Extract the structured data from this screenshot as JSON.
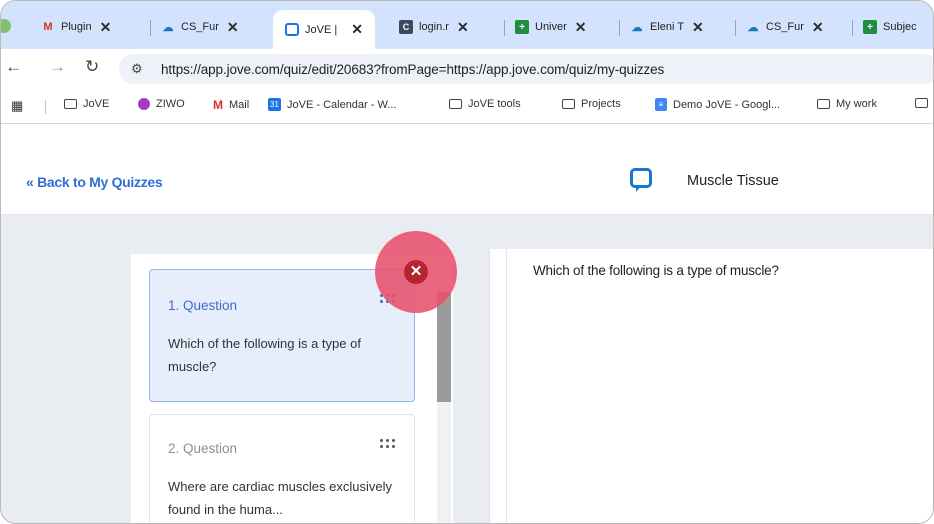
{
  "tabs": [
    {
      "label": "Plugin",
      "icon": "gmail-icon"
    },
    {
      "label": "CS_Fur",
      "icon": "salesforce-icon"
    },
    {
      "label": "JoVE |",
      "icon": "jove-icon",
      "active": true
    },
    {
      "label": "login.r",
      "icon": "login-icon"
    },
    {
      "label": "Univer",
      "icon": "sheets-icon"
    },
    {
      "label": "Eleni T",
      "icon": "salesforce-icon"
    },
    {
      "label": "CS_Fur",
      "icon": "salesforce-icon"
    },
    {
      "label": "Subjec",
      "icon": "sheets-icon"
    }
  ],
  "toolbar": {
    "url": "https://app.jove.com/quiz/edit/20683?fromPage=https://app.jove.com/quiz/my-quizzes"
  },
  "bookmarks": [
    {
      "label": "JoVE",
      "icon": "folder-icon"
    },
    {
      "label": "ZIWO",
      "icon": "ziwo-icon"
    },
    {
      "label": "Mail",
      "icon": "gmail-icon"
    },
    {
      "label": "JoVE - Calendar - W...",
      "icon": "calendar-icon"
    },
    {
      "label": "JoVE tools",
      "icon": "folder-icon"
    },
    {
      "label": "Projects",
      "icon": "folder-icon"
    },
    {
      "label": "Demo JoVE - Googl...",
      "icon": "docs-icon"
    },
    {
      "label": "My work",
      "icon": "folder-icon"
    }
  ],
  "page": {
    "back_label": "Back to My Quizzes",
    "quiz_title": "Muscle Tissue"
  },
  "questions": [
    {
      "label": "1. Question",
      "text": "Which of the following is a type of muscle?",
      "selected": true
    },
    {
      "label": "2. Question",
      "text": "Where are cardiac muscles exclusively found in the huma...",
      "selected": false
    }
  ],
  "editor": {
    "question_text": "Which of the following is a type of muscle?"
  },
  "colors": {
    "tab_strip": "#d3e3fd",
    "link_blue": "#2f6fd6",
    "selected_card": "#e6eefc",
    "close_red": "#b3262f"
  }
}
